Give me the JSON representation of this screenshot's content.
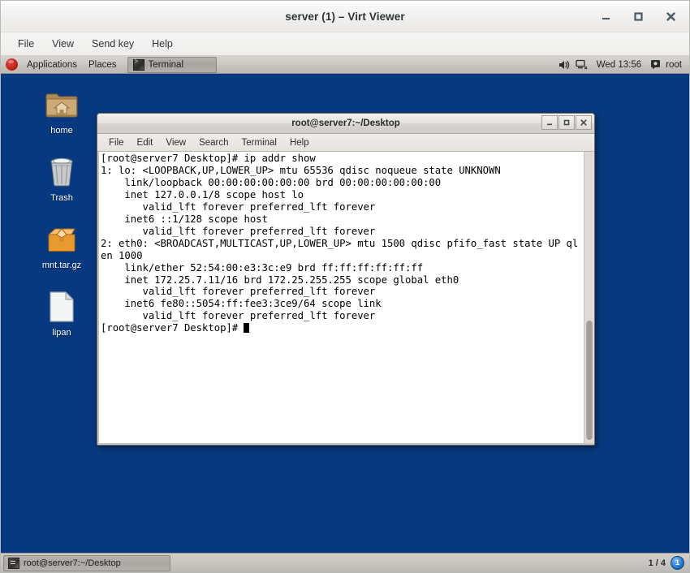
{
  "virt_viewer": {
    "title": "server (1) – Virt Viewer",
    "menu": [
      "File",
      "View",
      "Send key",
      "Help"
    ],
    "window_controls": [
      {
        "name": "minimize-button",
        "glyph": "minimize"
      },
      {
        "name": "maximize-button",
        "glyph": "maximize"
      },
      {
        "name": "close-button",
        "glyph": "close"
      }
    ]
  },
  "gnome_panel": {
    "logo": "fedora-logo",
    "applications_label": "Applications",
    "places_label": "Places",
    "window_button_label": "Terminal",
    "tray": {
      "volume_icon": "volume-icon",
      "network_icon": "network-icon",
      "clock": "Wed 13:56",
      "user_icon": "user-icon",
      "user": "root"
    }
  },
  "desktop": {
    "background_color": "#06397f",
    "icons": [
      {
        "label": "home",
        "icon": "home-folder-icon"
      },
      {
        "label": "Trash",
        "icon": "trash-icon"
      },
      {
        "label": "mnt.tar.gz",
        "icon": "archive-icon"
      },
      {
        "label": "lipan",
        "icon": "document-icon"
      }
    ]
  },
  "terminal": {
    "title": "root@server7:~/Desktop",
    "menu": [
      "File",
      "Edit",
      "View",
      "Search",
      "Terminal",
      "Help"
    ],
    "window_controls": [
      {
        "name": "minimize-button",
        "glyph": "_"
      },
      {
        "name": "maximize-button",
        "glyph": "□"
      },
      {
        "name": "close-button",
        "glyph": "✕"
      }
    ],
    "content": "[root@server7 Desktop]# ip addr show\n1: lo: <LOOPBACK,UP,LOWER_UP> mtu 65536 qdisc noqueue state UNKNOWN\n    link/loopback 00:00:00:00:00:00 brd 00:00:00:00:00:00\n    inet 127.0.0.1/8 scope host lo\n       valid_lft forever preferred_lft forever\n    inet6 ::1/128 scope host\n       valid_lft forever preferred_lft forever\n2: eth0: <BROADCAST,MULTICAST,UP,LOWER_UP> mtu 1500 qdisc pfifo_fast state UP ql\nen 1000\n    link/ether 52:54:00:e3:3c:e9 brd ff:ff:ff:ff:ff:ff\n    inet 172.25.7.11/16 brd 172.25.255.255 scope global eth0\n       valid_lft forever preferred_lft forever\n    inet6 fe80::5054:ff:fee3:3ce9/64 scope link\n       valid_lft forever preferred_lft forever\n",
    "prompt": "[root@server7 Desktop]# "
  },
  "taskbar": {
    "window_label": "root@server7:~/Desktop",
    "workspace_indicator": "1 / 4",
    "workspace_badge": "1"
  }
}
